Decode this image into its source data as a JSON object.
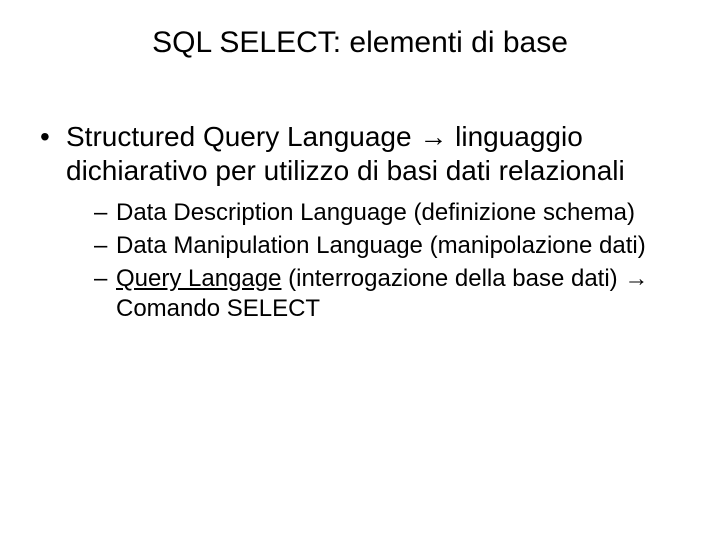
{
  "title": "SQL SELECT: elementi di base",
  "bullet1": {
    "prefix": "Structured Query Language ",
    "arrow": "→",
    "suffix": " linguaggio dichiarativo per utilizzo di basi dati relazionali"
  },
  "sub": {
    "s1": "Data Description Language (definizione schema)",
    "s2": "Data Manipulation Language (manipolazione dati)",
    "s3": {
      "underlined": "Query Langage",
      "after": " (interrogazione della base dati) ",
      "arrow": "→",
      "tail": " Comando SELECT"
    }
  }
}
